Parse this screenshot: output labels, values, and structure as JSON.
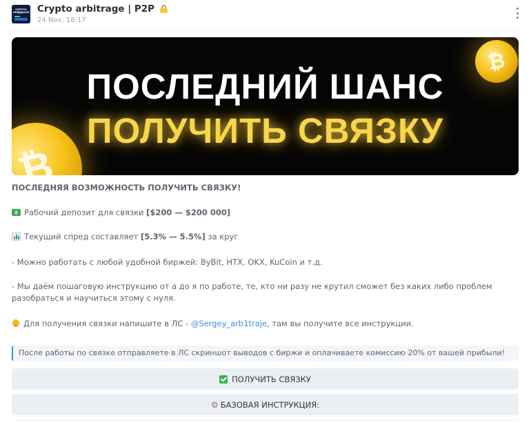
{
  "header": {
    "channel_title": "Crypto arbitrage | P2P",
    "avatar_line1": "CRYPTO ARBITRAGE",
    "avatar_line2": "P2P",
    "date": "24 Nov, 18:17"
  },
  "banner": {
    "line1": "ПОСЛЕДНИЙ ШАНС",
    "line2": "ПОЛУЧИТЬ СВЯЗКУ",
    "coin_symbol": "₿"
  },
  "post": {
    "heading": "ПОСЛЕДНЯЯ ВОЗМОЖНОСТЬ ПОЛУЧИТЬ СВЯЗКУ!",
    "deposit_prefix": "Рабочий депозит для связки ",
    "deposit_value": "[$200 — $200 000]",
    "spread_prefix": "Текущий спред составляет ",
    "spread_value": "[5.3% — 5.5%]",
    "spread_suffix": " за круг",
    "exchanges": "- Можно работать с любой удобной биржей: ByBit, HTX, OKX, KuCoin и т.д.",
    "instruction": "- Мы даём пошаговую инструкцию от а до я по работе, те, кто ни разу не крутил сможет без каких либо проблем разобраться и научиться этому с нуля.",
    "contact_prefix": "Для получения связки напишите в ЛС - ",
    "contact_link": "@Sergey_arb1traje",
    "contact_suffix": ", там вы получите все инструкции."
  },
  "quote": {
    "text": "После работы по связке отправляете в ЛС скриншот выводов с биржи и оплачиваете комиссию 20% от вашей прибыли!"
  },
  "buttons": {
    "get_bundle": "ПОЛУЧИТЬ СВЯЗКУ",
    "basic_instruction": "БАЗОВАЯ ИНСТРУКЦИЯ:"
  },
  "colors": {
    "accent_link": "#3a8fd9",
    "banner_yellow": "#f8d64a",
    "button_bg": "#eceff2"
  },
  "icons": {
    "menu": "more-vertical-icon",
    "lock": "lock-icon",
    "money": "dollar-banknote-icon",
    "chart": "bar-chart-icon",
    "bell": "bell-icon",
    "check": "check-mark-icon",
    "gear": "gear-icon"
  }
}
